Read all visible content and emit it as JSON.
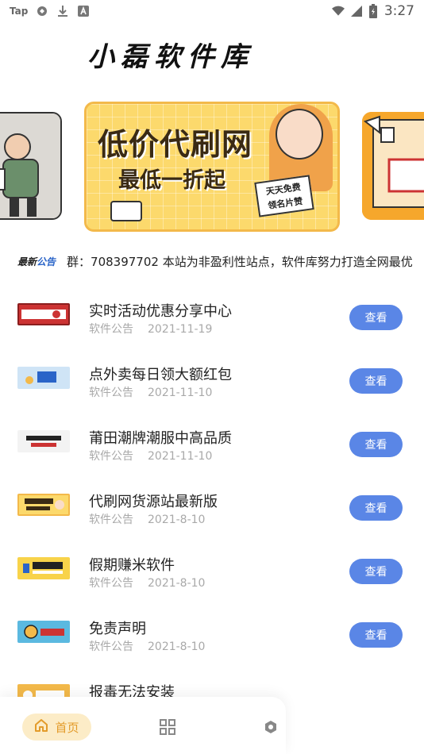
{
  "status_bar": {
    "left": {
      "app": "Tap",
      "icons": [
        "sync-icon",
        "download-icon",
        "font-icon"
      ]
    },
    "right": {
      "icons": [
        "wifi-icon",
        "signal-icon",
        "battery-icon"
      ],
      "time": "3:27"
    }
  },
  "header": {
    "title": "小磊软件库"
  },
  "carousel": {
    "main_banner": {
      "line1": "低价代刷网",
      "line2": "最低一折起",
      "note": "天天免费\n领名片赞"
    },
    "colors": {
      "main": "#fcd96c",
      "right": "#f6a72c"
    }
  },
  "notice": {
    "badge_new": "最新",
    "badge_label": "公告",
    "text": "群：708397702 本站为非盈利性站点，软件库努力打造全网最优"
  },
  "list": {
    "items": [
      {
        "title": "实时活动优惠分享中心",
        "category": "软件公告",
        "date": "2021-11-19",
        "button": "查看",
        "thumb_color": "#c33"
      },
      {
        "title": "点外卖每日领大额红包",
        "category": "软件公告",
        "date": "2021-11-10",
        "button": "查看",
        "thumb_color": "#cfe4f6"
      },
      {
        "title": "莆田潮牌潮服中高品质",
        "category": "软件公告",
        "date": "2021-11-10",
        "button": "查看",
        "thumb_color": "#f3f3f3"
      },
      {
        "title": "代刷网货源站最新版",
        "category": "软件公告",
        "date": "2021-8-10",
        "button": "查看",
        "thumb_color": "#fcd96c"
      },
      {
        "title": "假期赚米软件",
        "category": "软件公告",
        "date": "2021-8-10",
        "button": "查看",
        "thumb_color": "#f8d34a"
      },
      {
        "title": "免责声明",
        "category": "软件公告",
        "date": "2021-8-10",
        "button": "查看",
        "thumb_color": "#5bb9e0"
      },
      {
        "title": "报毒无法安装",
        "category": "",
        "date": "",
        "button": "",
        "thumb_color": "#f3b94a"
      }
    ]
  },
  "bottom_nav": {
    "home_label": "首页",
    "accent": "#e39b2a"
  }
}
